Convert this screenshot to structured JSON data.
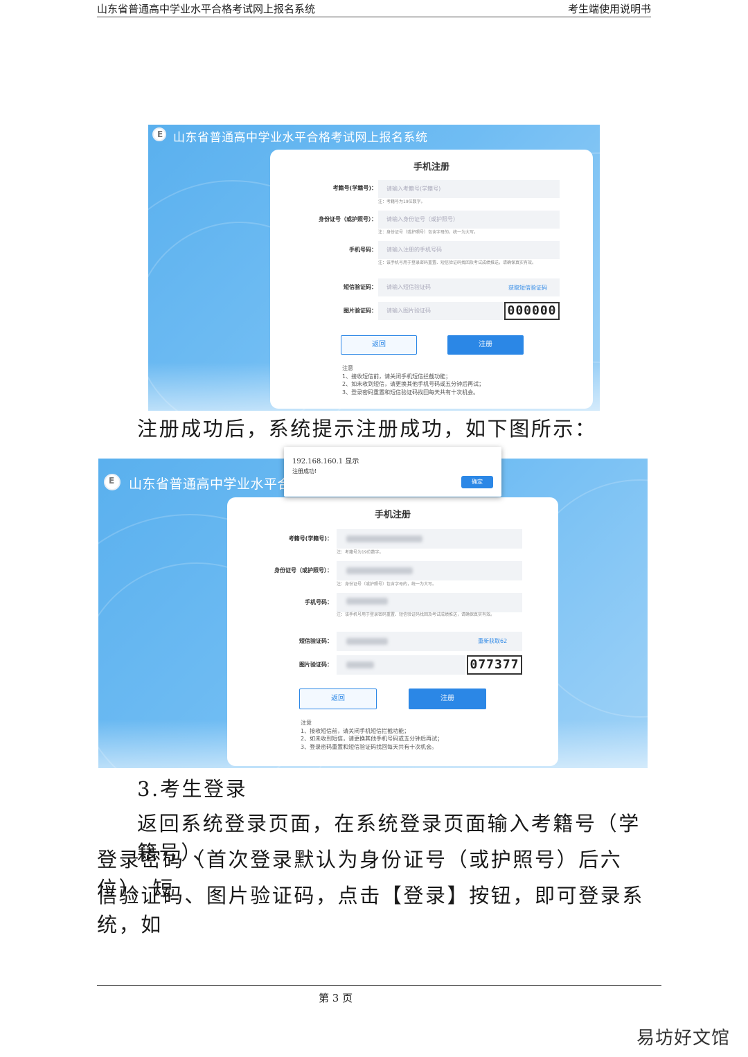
{
  "header": {
    "left": "山东省普通高中学业水平合格考试网上报名系统",
    "right": "考生端使用说明书"
  },
  "shot1": {
    "app_title": "山东省普通高中学业水平合格考试网上报名系统",
    "card_title": "手机注册",
    "fields": [
      {
        "label": "考籍号(学籍号)：",
        "placeholder": "请输入考籍号(学籍号)",
        "note": "注：考籍号为19位数字。"
      },
      {
        "label": "身份证号（或护照号）：",
        "placeholder": "请输入身份证号（或护照号）",
        "note": "注：身份证号（或护照号）包含字母的，统一为大写。"
      },
      {
        "label": "手机号码：",
        "placeholder": "请输入注册的手机号码",
        "note": "注：该手机号用于登录密码重置、短信验证码找回及考试成绩推送，请确保真实有效。"
      },
      {
        "label": "短信验证码：",
        "placeholder": "请输入短信验证码",
        "link": "获取短信验证码"
      },
      {
        "label": "图片验证码：",
        "placeholder": "请输入图片验证码",
        "captcha": "000000"
      }
    ],
    "back_label": "返回",
    "register_label": "注册",
    "notes_title": "注意",
    "notes": [
      "1、接收短信前，请关闭手机短信拦截功能；",
      "2、如未收到短信，请更换其他手机号码或五分钟后再试；",
      "3、登录密码重置和短信验证码找回每天共有十次机会。"
    ]
  },
  "caption1": "注册成功后，系统提示注册成功，如下图所示：",
  "shot2": {
    "app_title": "山东省普通高中学业水平合",
    "dialog_origin": "192.168.160.1 显示",
    "dialog_message": "注册成功!",
    "dialog_ok": "确定",
    "card_title": "手机注册",
    "fields": [
      {
        "label": "考籍号(学籍号)：",
        "note": "注：考籍号为19位数字。"
      },
      {
        "label": "身份证号（或护照号）：",
        "note": "注：身份证号（或护照号）包含字母的，统一为大写。"
      },
      {
        "label": "手机号码：",
        "note": "注：该手机号用于登录密码重置、短信验证码找回及考试成绩推送，请确保真实有效。"
      },
      {
        "label": "短信验证码：",
        "link": "重新获取62"
      },
      {
        "label": "图片验证码：",
        "captcha": "077377"
      }
    ],
    "back_label": "返回",
    "register_label": "注册",
    "notes_title": "注意",
    "notes": [
      "1、接收短信前，请关闭手机短信拦截功能；",
      "2、如未收到短信，请更换其他手机号码或五分钟后再试；",
      "3、登录密码重置和短信验证码找回每天共有十次机会。"
    ]
  },
  "section_heading": "3.考生登录",
  "paragraph_lines": [
    "返回系统登录页面，在系统登录页面输入考籍号（学籍号）、",
    "登录密码（首次登录默认为身份证号（或护照号）后六位）、短",
    "信验证码、图片验证码，点击【登录】按钮，即可登录系统，如"
  ],
  "footer": {
    "page": "第 3 页"
  },
  "watermark": "易坊好文馆"
}
